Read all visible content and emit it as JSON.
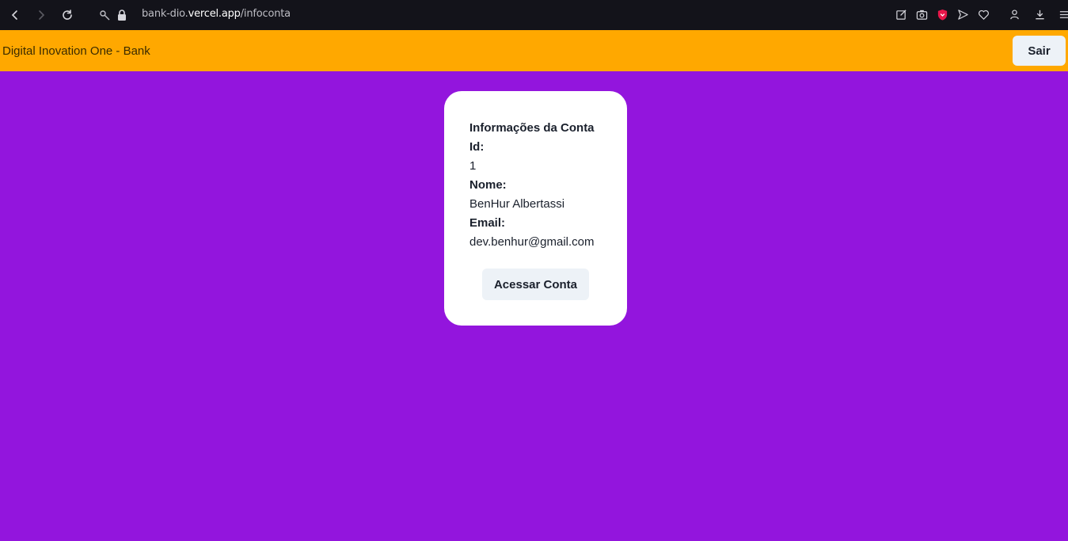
{
  "browser": {
    "url_prefix": "bank-dio.",
    "url_domain": "vercel.app",
    "url_path": "/infoconta"
  },
  "header": {
    "title": "Digital Inovation One - Bank",
    "logout_label": "Sair"
  },
  "account_card": {
    "heading": "Informações da Conta",
    "id_label": "Id:",
    "id_value": "1",
    "name_label": "Nome:",
    "name_value": "BenHur Albertassi",
    "email_label": "Email:",
    "email_value": "dev.benhur@gmail.com",
    "access_button_label": "Acessar Conta"
  },
  "colors": {
    "background": "#9315dd",
    "header": "#ffa800",
    "card": "#ffffff",
    "button": "#edf2f7"
  },
  "icons": [
    "back-icon",
    "forward-icon",
    "reload-icon",
    "key-icon",
    "lock-icon",
    "edit-icon",
    "camera-icon",
    "shield-icon",
    "send-icon",
    "heart-icon",
    "profile-icon",
    "download-icon",
    "menu-icon"
  ]
}
